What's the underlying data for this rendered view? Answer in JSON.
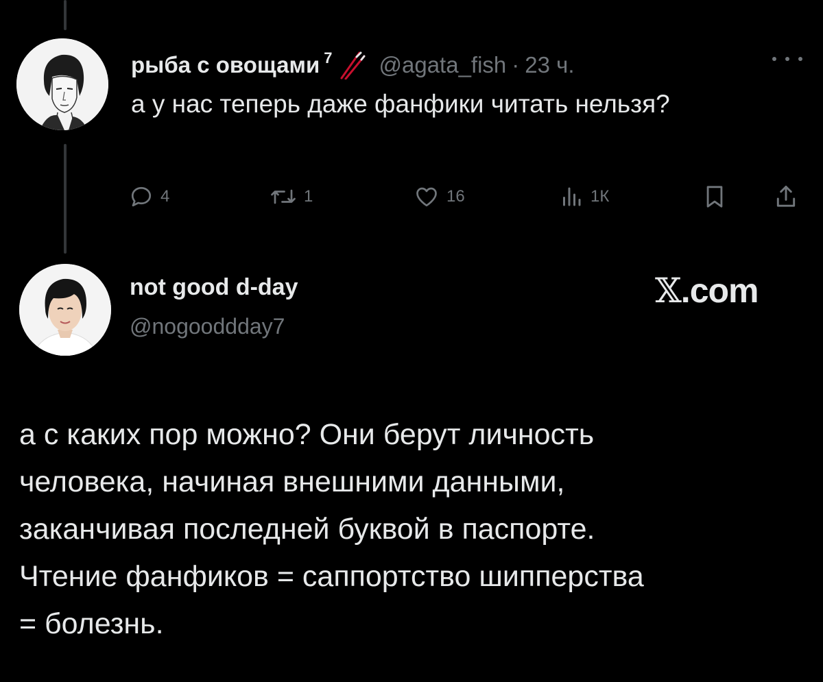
{
  "tweet1": {
    "display_name": "рыба с овощами",
    "superscript": "7",
    "emoji_icon": "chopsticks-icon",
    "handle": "@agata_fish",
    "separator": "·",
    "time": "23 ч.",
    "text": "а  у нас теперь даже фанфики читать нельзя?",
    "actions": {
      "replies": "4",
      "reposts": "1",
      "likes": "16",
      "views": "1К"
    }
  },
  "tweet2": {
    "display_name": "not good d-day",
    "handle": "@nogooddday7",
    "brand": ".com",
    "text_lines": [
      "а с каких пор можно? Они берут личность",
      "человека, начиная внешними данными,",
      "заканчивая последней буквой в паспорте.",
      "Чтение фанфиков  = саппортство шипперства",
      "= болезнь."
    ]
  },
  "colors": {
    "background": "#000000",
    "text": "#e7e9ea",
    "muted": "#71767b",
    "thread_line": "#333639",
    "chopsticks": "#c8102e"
  }
}
